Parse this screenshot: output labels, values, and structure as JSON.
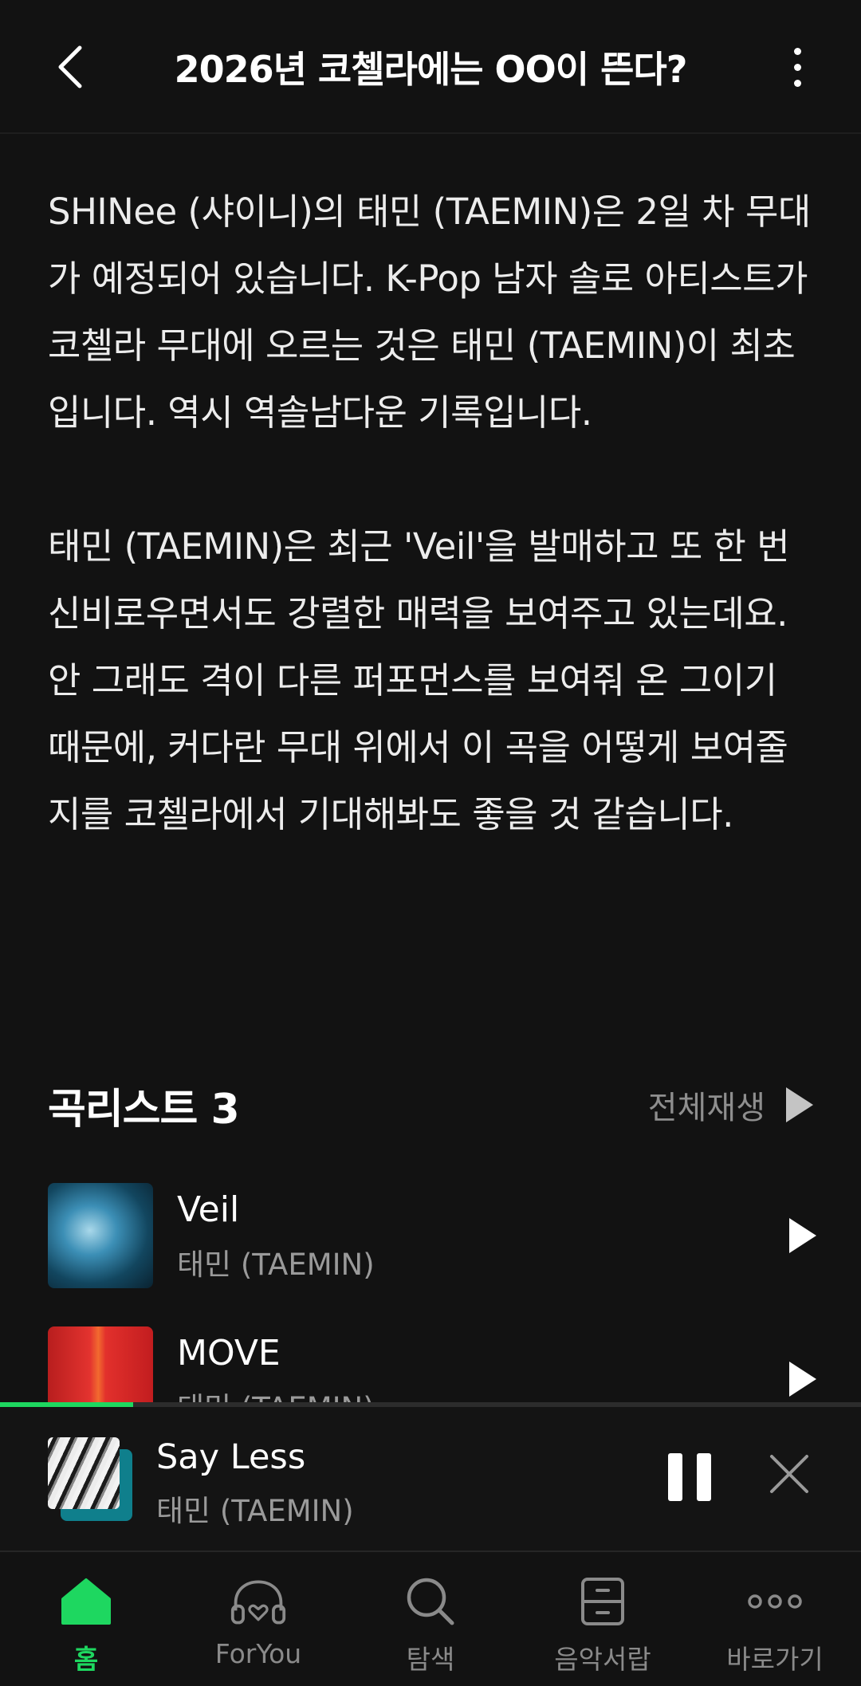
{
  "header": {
    "title": "2026년 코첼라에는 OO이 뜬다?",
    "back_icon": "chevron-left-icon",
    "more_icon": "more-vertical-icon"
  },
  "article": {
    "paragraphs": [
      "SHINee (샤이니)의 태민 (TAEMIN)은 2일 차 무대가 예정되어 있습니다. K-Pop 남자 솔로 아티스트가 코첼라 무대에 오르는 것은 태민 (TAEMIN)이 최초입니다. 역시 역솔남다운 기록입니다.",
      "태민 (TAEMIN)은 최근 'Veil'을 발매하고 또 한 번 신비로우면서도 강렬한 매력을 보여주고 있는데요. 안 그래도 격이 다른 퍼포먼스를 보여줘 온 그이기 때문에, 커다란 무대 위에서 이 곡을 어떻게 보여줄지를 코첼라에서 기대해봐도 좋을 것 같습니다."
    ]
  },
  "songlist": {
    "title": "곡리스트 3",
    "play_all_label": "전체재생",
    "songs": [
      {
        "title": "Veil",
        "artist": "태민 (TAEMIN)"
      },
      {
        "title": "MOVE",
        "artist": "태민 (TAEMIN)"
      }
    ]
  },
  "player": {
    "title": "Say Less",
    "artist": "태민 (TAEMIN)",
    "progress": 0.155,
    "state": "playing"
  },
  "nav": {
    "items": [
      {
        "label": "홈",
        "icon": "home-icon",
        "active": true
      },
      {
        "label": "ForYou",
        "icon": "headphones-heart-icon",
        "active": false
      },
      {
        "label": "탐색",
        "icon": "search-icon",
        "active": false
      },
      {
        "label": "음악서랍",
        "icon": "drawer-icon",
        "active": false
      },
      {
        "label": "바로가기",
        "icon": "more-horizontal-icon",
        "active": false
      }
    ]
  },
  "colors": {
    "background": "#121212",
    "accent": "#1ed760",
    "secondary_text": "#9a9a9a"
  }
}
